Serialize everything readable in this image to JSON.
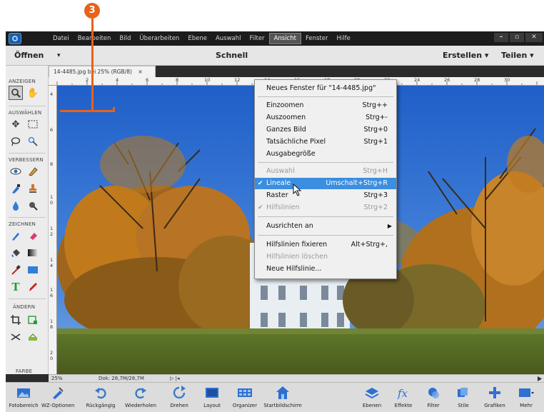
{
  "callout": {
    "number": "3"
  },
  "menubar": {
    "items": [
      "Datei",
      "Bearbeiten",
      "Bild",
      "Überarbeiten",
      "Ebene",
      "Auswahl",
      "Filter",
      "Ansicht",
      "Fenster",
      "Hilfe"
    ],
    "active": "Ansicht",
    "window_controls": [
      "–",
      "▫",
      "✕"
    ]
  },
  "optionbar": {
    "open_label": "Öffnen",
    "open_arrow": "▾",
    "mode_label": "Schnell",
    "create_label": "Erstellen ▾",
    "share_label": "Teilen ▾"
  },
  "toolbox": {
    "sections": [
      "ANZEIGEN",
      "AUSWÄHLEN",
      "VERBESSERN",
      "ZEICHNEN",
      "ÄNDERN",
      "FARBE"
    ]
  },
  "document": {
    "tab_label": "14-4485.jpg bei 25% (RGB/8)",
    "tab_close": "×",
    "ruler_h": [
      "2",
      "4",
      "6",
      "8",
      "10",
      "12",
      "14",
      "16",
      "18",
      "20",
      "22",
      "24",
      "26",
      "28",
      "30"
    ],
    "ruler_v": [
      "4",
      "6",
      "8",
      "1\n0",
      "1\n2",
      "1\n4",
      "1\n6",
      "1\n8",
      "2\n0"
    ]
  },
  "status": {
    "zoom": "25%",
    "doc": "Dok: 28,7M/28,7M",
    "nav": "▷ |◂"
  },
  "menu": {
    "items": [
      {
        "label": "Neues Fenster für \"14-4485.jpg\"",
        "shortcut": "",
        "state": "normal"
      },
      {
        "label": "Einzoomen",
        "shortcut": "Strg++",
        "state": "normal"
      },
      {
        "label": "Auszoomen",
        "shortcut": "Strg+-",
        "state": "normal"
      },
      {
        "label": "Ganzes Bild",
        "shortcut": "Strg+0",
        "state": "normal"
      },
      {
        "label": "Tatsächliche Pixel",
        "shortcut": "Strg+1",
        "state": "normal"
      },
      {
        "label": "Ausgabegröße",
        "shortcut": "",
        "state": "normal"
      },
      {
        "label": "Auswahl",
        "shortcut": "Strg+H",
        "state": "disabled"
      },
      {
        "label": "Lineale",
        "shortcut": "Umschalt+Strg+R",
        "state": "highlighted-checked"
      },
      {
        "label": "Raster",
        "shortcut": "Strg+3",
        "state": "normal"
      },
      {
        "label": "Hilfslinien",
        "shortcut": "Strg+2",
        "state": "disabled-checked"
      },
      {
        "label": "Ausrichten an",
        "shortcut": "",
        "state": "submenu"
      },
      {
        "label": "Hilfslinien fixieren",
        "shortcut": "Alt+Strg+,",
        "state": "normal"
      },
      {
        "label": "Hilfslinien löschen",
        "shortcut": "",
        "state": "disabled"
      },
      {
        "label": "Neue Hilfslinie...",
        "shortcut": "",
        "state": "normal"
      }
    ],
    "check_glyph": "✔",
    "submenu_glyph": "▶"
  },
  "taskbar": {
    "items": [
      {
        "label": "Fotobereich",
        "icon": "photo-bin-icon"
      },
      {
        "label": "WZ-Optionen",
        "icon": "tool-options-icon"
      },
      {
        "label": "Rückgängig",
        "icon": "undo-icon"
      },
      {
        "label": "Wiederholen",
        "icon": "redo-icon"
      },
      {
        "label": "Drehen",
        "icon": "rotate-icon"
      },
      {
        "label": "Layout",
        "icon": "layout-icon"
      },
      {
        "label": "Organizer",
        "icon": "organizer-icon"
      },
      {
        "label": "Startbildschirm",
        "icon": "home-icon"
      },
      {
        "label": "Ebenen",
        "icon": "layers-icon"
      },
      {
        "label": "Effekte",
        "icon": "fx-icon"
      },
      {
        "label": "Filter",
        "icon": "filter-icon"
      },
      {
        "label": "Stile",
        "icon": "styles-icon"
      },
      {
        "label": "Grafiken",
        "icon": "graphics-icon"
      },
      {
        "label": "Mehr",
        "icon": "more-icon"
      }
    ]
  },
  "colors": {
    "accent": "#e8621a",
    "menu_highlight": "#3b8ee0",
    "sky": "#2f6fd2",
    "foliage": "#c07a1c"
  }
}
